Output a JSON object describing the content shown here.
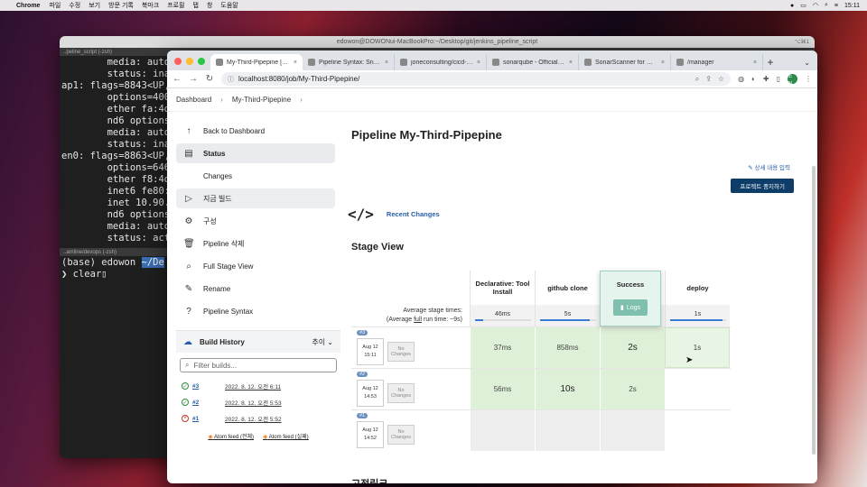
{
  "menubar": {
    "app": "Chrome",
    "items": [
      "파일",
      "수정",
      "보기",
      "방문 기록",
      "북마크",
      "프로필",
      "탭",
      "창",
      "도움말"
    ],
    "time": "15:11"
  },
  "terminal": {
    "title": "edowon@DOWONui-MacBookPro:~/Desktop/git/jenkins_pipeline_script",
    "title_tag": "⌥⌘1",
    "tab1": "..peline_script (-zsh)",
    "tab2": "..amline/devops (-zsh)",
    "lines": [
      "        media: autose",
      "        status: inact",
      "ap1: flags=8843<UP,BR",
      "        options=400<C",
      "        ether fa:4d:8",
      "        nd6 options=20",
      "        media: autose",
      "        status: inact",
      "en0: flags=8863<UP,BR",
      "        options=6463<",
      "        ether f8:4d:8",
      "        inet6 fe80::1",
      "        inet 10.90.1.",
      "        nd6 options=20",
      "        media: autose",
      "        status: active"
    ],
    "prompt_env": "(base)",
    "prompt_user": "edowon",
    "prompt_cwd": "~/De",
    "command": "clear"
  },
  "browser": {
    "tabs": [
      {
        "label": "My-Third-Pipepine [Jenkins]",
        "active": true
      },
      {
        "label": "Pipeline Syntax: Snippet"
      },
      {
        "label": "joneconsulting/cicd-web"
      },
      {
        "label": "sonarqube - Official Ima"
      },
      {
        "label": "SonarScanner for Maven"
      },
      {
        "label": "/manager"
      }
    ],
    "url": "localhost:8080/job/My-Third-Pipepine/",
    "avatar": "도원"
  },
  "jenkins": {
    "breadcrumbs": [
      "Dashboard",
      "My-Third-Pipepine"
    ],
    "nav": [
      {
        "label": "Back to Dashboard",
        "icon": "arrow-up-icon",
        "glyph": "↑"
      },
      {
        "label": "Status",
        "icon": "document-icon",
        "glyph": "▤"
      },
      {
        "label": "Changes",
        "icon": "code-icon",
        "glyph": "</>"
      },
      {
        "label": "지금 빌드",
        "icon": "play-icon",
        "glyph": "▷"
      },
      {
        "label": "구성",
        "icon": "gear-icon",
        "glyph": "⚙"
      },
      {
        "label": "Pipeline 삭제",
        "icon": "trash-icon",
        "glyph": "🗑"
      },
      {
        "label": "Full Stage View",
        "icon": "search-icon",
        "glyph": "⌕"
      },
      {
        "label": "Rename",
        "icon": "pencil-icon",
        "glyph": "✎"
      },
      {
        "label": "Pipeline Syntax",
        "icon": "help-icon",
        "glyph": "?"
      }
    ],
    "build_history": {
      "title": "Build History",
      "trend": "추이",
      "filter_placeholder": "Filter builds...",
      "builds": [
        {
          "num": "#3",
          "date": "2022. 8. 12. 오전 6:11",
          "status": "success"
        },
        {
          "num": "#2",
          "date": "2022. 8. 12. 오전 5:53",
          "status": "success"
        },
        {
          "num": "#1",
          "date": "2022. 8. 12. 오전 5:52",
          "status": "failed"
        }
      ],
      "feed_all": "Atom feed (전체)",
      "feed_failed": "Atom feed (실패)"
    },
    "title": "Pipeline My-Third-Pipepine",
    "edit_description": "상세 내용 입력",
    "disable_button": "프로젝트 중지하기",
    "recent_changes": "Recent Changes",
    "stage_view_title": "Stage View",
    "stage_view": {
      "stages": [
        "Declarative: Tool Install",
        "github clone",
        "Success",
        "deploy"
      ],
      "avg_label_1": "Average stage times:",
      "avg_label_2a": "(Average ",
      "avg_label_full": "full",
      "avg_label_2b": " run time: ~9s)",
      "avg_times": [
        "46ms",
        "5s",
        "",
        "1s"
      ],
      "avg_fill": [
        0.15,
        0.9,
        0.0,
        0.95
      ],
      "runs": [
        {
          "badge": "#3",
          "date": "Aug 12",
          "time": "15:11",
          "changes": "No Changes",
          "cells": [
            "37ms",
            "858ms",
            "2s",
            "1s"
          ],
          "types": [
            "ok",
            "ok",
            "okbig",
            "hot"
          ]
        },
        {
          "badge": "#2",
          "date": "Aug 12",
          "time": "14:53",
          "changes": "No Changes",
          "cells": [
            "56ms",
            "10s",
            "2s",
            ""
          ],
          "types": [
            "ok",
            "okbig",
            "ok",
            "empty"
          ]
        },
        {
          "badge": "#1",
          "date": "Aug 12",
          "time": "14:52",
          "changes": "No Changes",
          "cells": [
            "",
            "",
            "",
            ""
          ],
          "types": [
            "grey",
            "grey",
            "grey",
            "empty"
          ]
        }
      ],
      "popup_title": "Success",
      "popup_button": "Logs"
    },
    "permalinks_title": "고정링크"
  }
}
